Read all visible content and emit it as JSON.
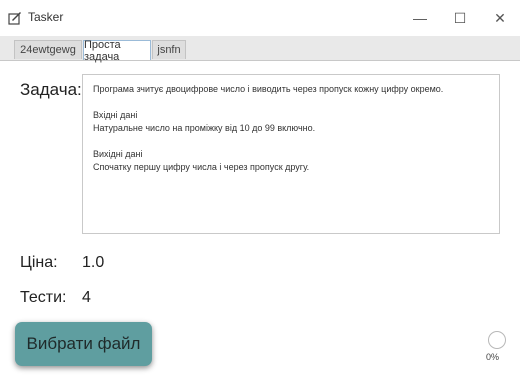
{
  "window": {
    "title": "Tasker",
    "minimize_glyph": "—",
    "maximize_glyph": "☐",
    "close_glyph": "✕"
  },
  "tabs": [
    {
      "label": "24ewtgewg",
      "active": false
    },
    {
      "label": "Проста задача",
      "active": true
    },
    {
      "label": "jsnfn",
      "active": false
    }
  ],
  "task": {
    "label": "Задача:",
    "description": "Програма зчитує двоцифрове число і виводить через пропуск кожну цифру окремо.\n\nВхідні дані\nНатуральне число на проміжку від 10 до 99 включно.\n\nВихідні дані\nСпочатку першу цифру числа і через пропуск другу."
  },
  "price": {
    "label": "Ціна:",
    "value": "1.0"
  },
  "tests": {
    "label": "Тести:",
    "value": "4"
  },
  "pick_file_button": {
    "label": "Вибрати файл"
  },
  "progress": {
    "value": 0,
    "text": "0%"
  },
  "colors": {
    "button_bg": "#5f9ea0",
    "active_tab_border": "#9bbbd8"
  }
}
